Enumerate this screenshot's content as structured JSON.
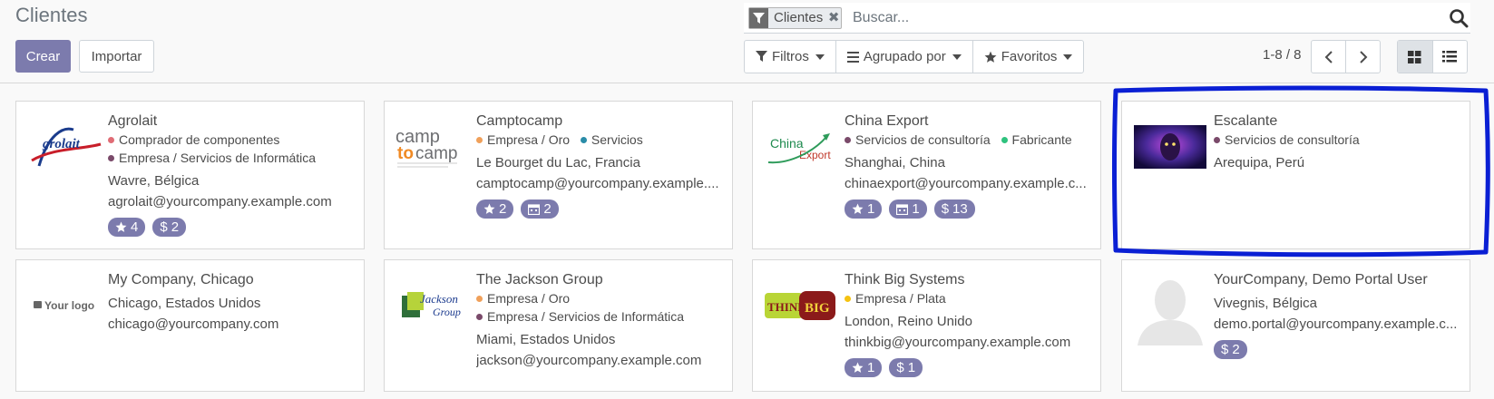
{
  "title": "Clientes",
  "buttons": {
    "create": "Crear",
    "import": "Importar"
  },
  "search": {
    "facet": "Clientes",
    "placeholder": "Buscar..."
  },
  "toolbar": {
    "filters": "Filtros",
    "group_by": "Agrupado por",
    "favorites": "Favoritos"
  },
  "pager": {
    "range": "1-8 / 8"
  },
  "cards": [
    {
      "name": "Agrolait",
      "logo": "Agrolait",
      "tags": [
        {
          "label": "Comprador de componentes",
          "color": "#e06c75"
        },
        {
          "label": "Empresa / Servicios de Informática",
          "color": "#7a4a6a"
        }
      ],
      "location": "Wavre, Bélgica",
      "email": "agrolait@yourcompany.example.com",
      "badges": [
        {
          "icon": "star",
          "value": "4"
        },
        {
          "icon": "dollar",
          "value": "2"
        }
      ]
    },
    {
      "name": "Camptocamp",
      "logo": "camptocamp",
      "tags": [
        {
          "label": "Empresa / Oro",
          "color": "#f0a05a"
        },
        {
          "label": "Servicios",
          "color": "#2a8ca8"
        }
      ],
      "location": "Le Bourget du Lac, Francia",
      "email": "camptocamp@yourcompany.example....",
      "badges": [
        {
          "icon": "star",
          "value": "2"
        },
        {
          "icon": "calendar",
          "value": "2"
        }
      ]
    },
    {
      "name": "China Export",
      "logo": "China Export",
      "tags": [
        {
          "label": "Servicios de consultoría",
          "color": "#7a4a6a"
        },
        {
          "label": "Fabricante",
          "color": "#2ec27e"
        }
      ],
      "location": "Shanghai, China",
      "email": "chinaexport@yourcompany.example.c...",
      "badges": [
        {
          "icon": "star",
          "value": "1"
        },
        {
          "icon": "calendar",
          "value": "1"
        },
        {
          "icon": "dollar",
          "value": "13"
        }
      ]
    },
    {
      "name": "Escalante",
      "logo": "image",
      "tags": [
        {
          "label": "Servicios de consultoría",
          "color": "#7a4a6a"
        }
      ],
      "location": "Arequipa, Perú",
      "email": "",
      "badges": []
    },
    {
      "name": "My Company, Chicago",
      "logo": "Your logo",
      "tags": [],
      "location": "Chicago, Estados Unidos",
      "email": "chicago@yourcompany.com",
      "badges": []
    },
    {
      "name": "The Jackson Group",
      "logo": "Jackson Group",
      "tags": [
        {
          "label": "Empresa / Oro",
          "color": "#f0a05a"
        },
        {
          "label": "Empresa / Servicios de Informática",
          "color": "#7a4a6a"
        }
      ],
      "location": "Miami, Estados Unidos",
      "email": "jackson@yourcompany.example.com",
      "badges": []
    },
    {
      "name": "Think Big Systems",
      "logo": "THINK BIG",
      "tags": [
        {
          "label": "Empresa / Plata",
          "color": "#f5c211"
        }
      ],
      "location": "London, Reino Unido",
      "email": "thinkbig@yourcompany.example.com",
      "badges": [
        {
          "icon": "star",
          "value": "1"
        },
        {
          "icon": "dollar",
          "value": "1"
        }
      ]
    },
    {
      "name": "YourCompany, Demo Portal User",
      "logo": "avatar",
      "tags": [],
      "location": "Vivegnis, Bélgica",
      "email": "demo.portal@yourcompany.example.c...",
      "badges": [
        {
          "icon": "dollar",
          "value": "2"
        }
      ]
    }
  ],
  "colors": {
    "primary": "#7c7bad",
    "highlight": "#0a1fd4"
  }
}
